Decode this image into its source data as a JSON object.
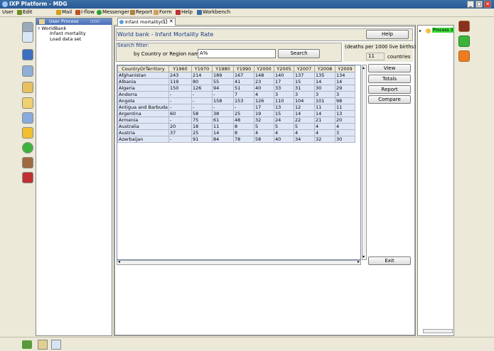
{
  "window": {
    "title": "IXP Platform - MDG",
    "controls": {
      "minimize": "_",
      "maximize": "□",
      "close": "✕"
    }
  },
  "menu": {
    "user": "User",
    "edit": "Edit",
    "mail": "Mail",
    "iflow": "I-flow",
    "messenger": "Messenger",
    "report": "Report",
    "form": "Form",
    "help": "Help",
    "workbench": "Workbench"
  },
  "user_process": {
    "title": "User Process",
    "tree_root": "WorldBank",
    "children": [
      "Infant mortality",
      "Load data set"
    ]
  },
  "tab": {
    "label": "Infant mortality(1)",
    "controls": "□ ✕"
  },
  "panel": {
    "heading": "World bank - Infant Mortality Rate",
    "help_button": "Help",
    "search_filter_title": "Search filter:",
    "search_label": "by Country or Region name:",
    "search_value": "A%",
    "search_button": "Search",
    "units_note": "(deaths per 1000 live births)",
    "country_count": "11",
    "countries_label": "countries",
    "view_button": "View",
    "totals_button": "Totals",
    "report_button": "Report",
    "compare_button": "Compare",
    "exit_button": "Exit"
  },
  "table": {
    "columns": [
      "CountryOrTerritory",
      "Y1960",
      "Y1970",
      "Y1980",
      "Y1990",
      "Y2000",
      "Y2005",
      "Y2007",
      "Y2008",
      "Y2009"
    ],
    "rows": [
      [
        "Afghanistan",
        "243",
        "214",
        "189",
        "167",
        "148",
        "140",
        "137",
        "135",
        "134"
      ],
      [
        "Albania",
        "119",
        "80",
        "55",
        "41",
        "23",
        "17",
        "15",
        "14",
        "14"
      ],
      [
        "Algeria",
        "150",
        "126",
        "94",
        "51",
        "40",
        "33",
        "31",
        "30",
        "29"
      ],
      [
        "Andorra",
        "-",
        "-",
        "-",
        "7",
        "4",
        "3",
        "3",
        "3",
        "3"
      ],
      [
        "Angola",
        "-",
        "-",
        "158",
        "153",
        "126",
        "110",
        "104",
        "101",
        "98"
      ],
      [
        "Antigua and Barbuda",
        "-",
        "-",
        "-",
        "-",
        "17",
        "13",
        "12",
        "11",
        "11"
      ],
      [
        "Argentina",
        "60",
        "58",
        "38",
        "25",
        "19",
        "15",
        "14",
        "14",
        "13"
      ],
      [
        "Armenia",
        "-",
        "75",
        "61",
        "48",
        "32",
        "24",
        "22",
        "21",
        "20"
      ],
      [
        "Australia",
        "20",
        "18",
        "11",
        "8",
        "5",
        "5",
        "5",
        "4",
        "4"
      ],
      [
        "Austria",
        "37",
        "25",
        "14",
        "8",
        "4",
        "4",
        "4",
        "4",
        "3"
      ],
      [
        "Azerbaijan",
        "-",
        "91",
        "84",
        "78",
        "58",
        "40",
        "34",
        "32",
        "30"
      ]
    ]
  },
  "right_panel": {
    "item": "Process 3"
  }
}
